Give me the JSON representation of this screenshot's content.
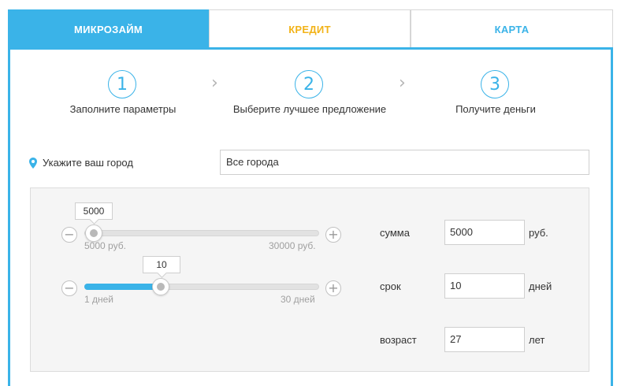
{
  "tabs": [
    {
      "label": "МИКРОЗАЙМ",
      "active": true
    },
    {
      "label": "КРЕДИТ",
      "active": false
    },
    {
      "label": "КАРТА",
      "active": false
    }
  ],
  "steps": [
    {
      "number": "1",
      "label": "Заполните параметры"
    },
    {
      "number": "2",
      "label": "Выберите лучшее предложение"
    },
    {
      "number": "3",
      "label": "Получите деньги"
    }
  ],
  "city": {
    "label": "Укажите ваш город",
    "value": "Все города"
  },
  "sliders": {
    "amount": {
      "tooltip": "5000",
      "min_label": "5000 руб.",
      "max_label": "30000 руб.",
      "min": 5000,
      "max": 30000,
      "value": 5000
    },
    "term": {
      "tooltip": "10",
      "min_label": "1 дней",
      "max_label": "30 дней",
      "min": 1,
      "max": 30,
      "value": 10
    }
  },
  "fields": {
    "amount": {
      "label": "сумма",
      "value": "5000",
      "unit": "руб."
    },
    "term": {
      "label": "срок",
      "value": "10",
      "unit": "дней"
    },
    "age": {
      "label": "возраст",
      "value": "27",
      "unit": "лет"
    }
  },
  "colors": {
    "accent": "#3ab3e8",
    "credit": "#f2b318"
  },
  "icons": {
    "minus": "minus-icon",
    "plus": "plus-icon",
    "pin": "map-pin-icon",
    "chevron": "chevron-right-icon"
  }
}
